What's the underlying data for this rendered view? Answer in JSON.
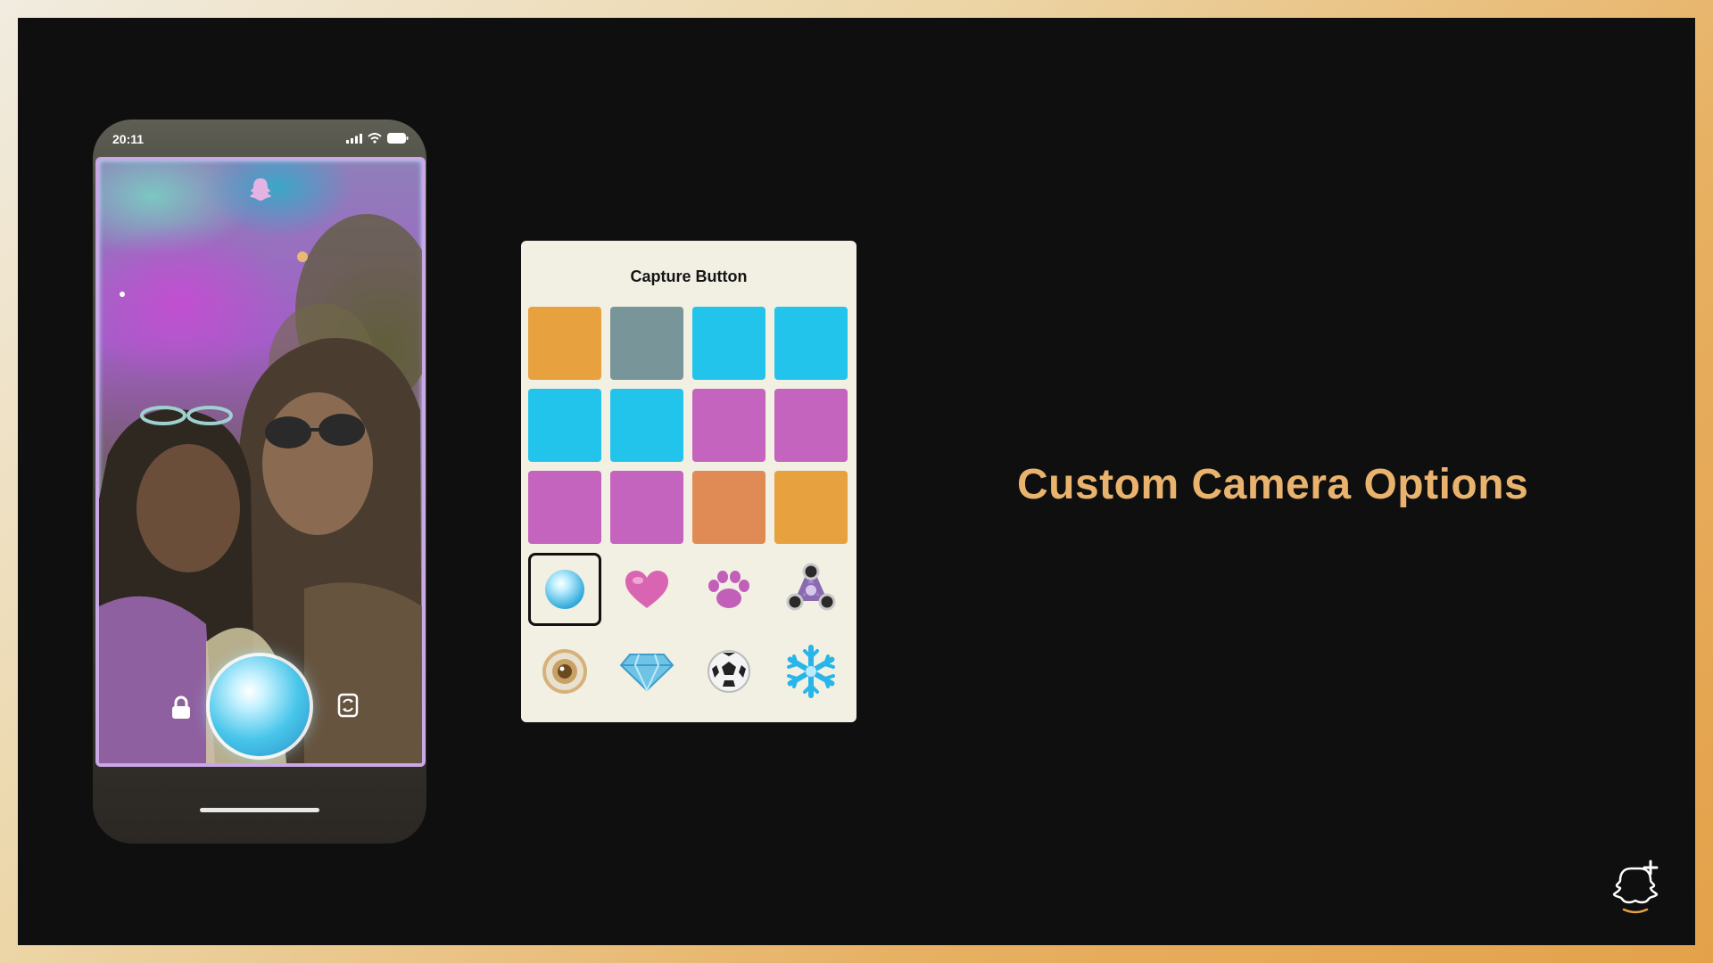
{
  "slide": {
    "headline": "Custom Camera Options",
    "headline_color": "#e9b36e",
    "background_color": "#0f0f0f"
  },
  "phone": {
    "status_time": "20:11",
    "status_icons": [
      "signal-icon",
      "wifi-icon",
      "battery-icon"
    ],
    "screen_icons": [
      "ghost-icon",
      "lock-icon",
      "capture-orb",
      "flip-camera-icon"
    ]
  },
  "picker": {
    "title": "Capture Button",
    "colors": [
      "#e7a23f",
      "#78969a",
      "#22c4ec",
      "#22c4ec",
      "#22c4ec",
      "#22c4ec",
      "#c464be",
      "#c464be",
      "#c464be",
      "#c464be",
      "#e08b56",
      "#e7a23f"
    ],
    "icon_items": [
      {
        "name": "bubble-icon",
        "selected": true
      },
      {
        "name": "heart-icon",
        "selected": false
      },
      {
        "name": "paw-icon",
        "selected": false
      },
      {
        "name": "fidget-spinner-icon",
        "selected": false
      },
      {
        "name": "donut-icon",
        "selected": false
      },
      {
        "name": "diamond-icon",
        "selected": false
      },
      {
        "name": "soccer-ball-icon",
        "selected": false
      },
      {
        "name": "snowflake-icon",
        "selected": false
      }
    ]
  },
  "brand": {
    "logo": "snapchat-plus-icon"
  }
}
